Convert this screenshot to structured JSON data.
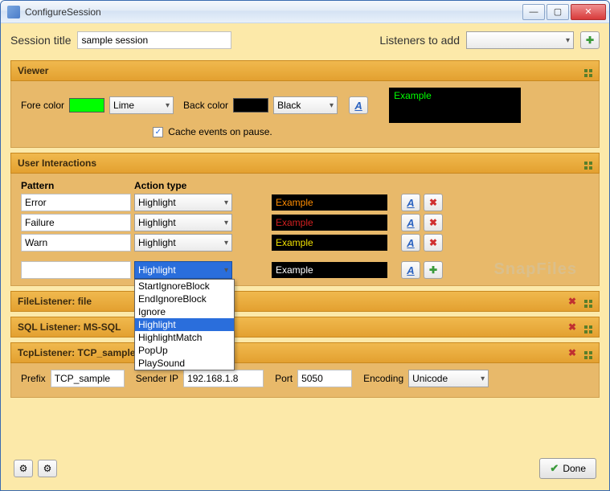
{
  "window": {
    "title": "ConfigureSession"
  },
  "top": {
    "session_title_label": "Session title",
    "session_title_value": "sample session",
    "listeners_label": "Listeners to add",
    "listeners_value": ""
  },
  "viewer": {
    "header": "Viewer",
    "fore_label": "Fore color",
    "fore_swatch_color": "#00ff00",
    "fore_value": "Lime",
    "back_label": "Back color",
    "back_swatch_color": "#000000",
    "back_value": "Black",
    "cache_checked": true,
    "cache_label": "Cache events on pause.",
    "preview_text": "Example"
  },
  "user_interactions": {
    "header": "User Interactions",
    "col_pattern": "Pattern",
    "col_action": "Action type",
    "rows": [
      {
        "pattern": "Error",
        "action": "Highlight",
        "example": "Example",
        "example_color": "#ff8c00"
      },
      {
        "pattern": "Failure",
        "action": "Highlight",
        "example": "Example",
        "example_color": "#d02020"
      },
      {
        "pattern": "Warn",
        "action": "Highlight",
        "example": "Example",
        "example_color": "#f0e000"
      }
    ],
    "new_row": {
      "pattern": "",
      "action": "Highlight",
      "example": "Example",
      "example_color": "#ffffff"
    },
    "dropdown_options": [
      "StartIgnoreBlock",
      "EndIgnoreBlock",
      "Ignore",
      "Highlight",
      "HighlightMatch",
      "PopUp",
      "PlaySound"
    ],
    "dropdown_selected": "Highlight"
  },
  "file_listener": {
    "header": "FileListener: file"
  },
  "sql_listener": {
    "header": "SQL Listener: MS-SQL"
  },
  "tcp_listener": {
    "header": "TcpListener: TCP_sample",
    "prefix_label": "Prefix",
    "prefix_value": "TCP_sample",
    "sender_label": "Sender IP",
    "sender_value": "192.168.1.8",
    "port_label": "Port",
    "port_value": "5050",
    "encoding_label": "Encoding",
    "encoding_value": "Unicode"
  },
  "footer": {
    "done_label": "Done"
  },
  "watermark": "SnapFiles"
}
